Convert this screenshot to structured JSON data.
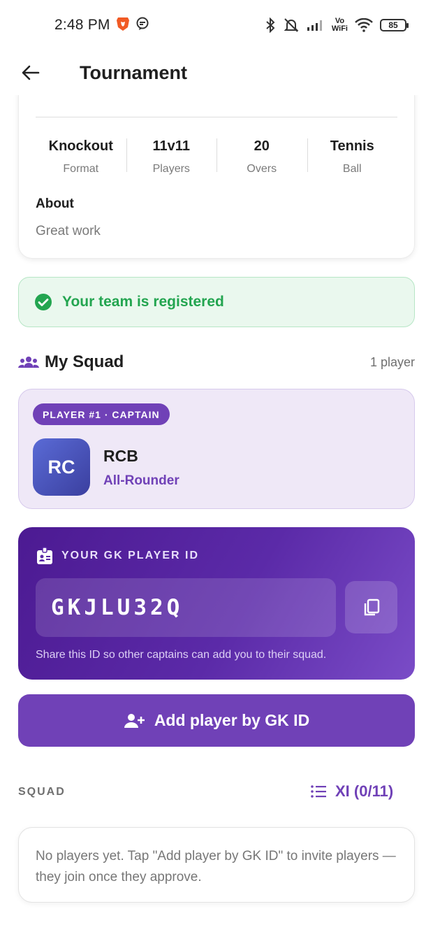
{
  "status_bar": {
    "time": "2:48 PM",
    "vowifi_top": "Vo",
    "vowifi_bottom": "WiFi",
    "battery": "85"
  },
  "app_bar": {
    "title": "Tournament"
  },
  "tournament_info": {
    "stats": [
      {
        "value": "Knockout",
        "label": "Format"
      },
      {
        "value": "11v11",
        "label": "Players"
      },
      {
        "value": "20",
        "label": "Overs"
      },
      {
        "value": "Tennis",
        "label": "Ball"
      }
    ],
    "about_label": "About",
    "about_text": "Great work"
  },
  "registration": {
    "message": "Your team is registered",
    "color": "#23a550"
  },
  "my_squad": {
    "title": "My Squad",
    "count": "1 player",
    "player": {
      "chip": "PLAYER #1 · CAPTAIN",
      "initials": "RC",
      "name": "RCB",
      "role": "All-Rounder"
    }
  },
  "gk_id_card": {
    "label": "YOUR GK PLAYER ID",
    "id": "GKJLU32Q",
    "hint": "Share this ID so other captains can add you to their squad."
  },
  "add_player": {
    "label": "Add player by GK ID"
  },
  "squad_section": {
    "label": "SQUAD",
    "xi_label": "XI (0/11)",
    "empty_text": "No players yet. Tap \"Add player by GK ID\" to invite players — they join once they approve."
  },
  "colors": {
    "accent": "#7041b7",
    "success": "#23a550"
  }
}
